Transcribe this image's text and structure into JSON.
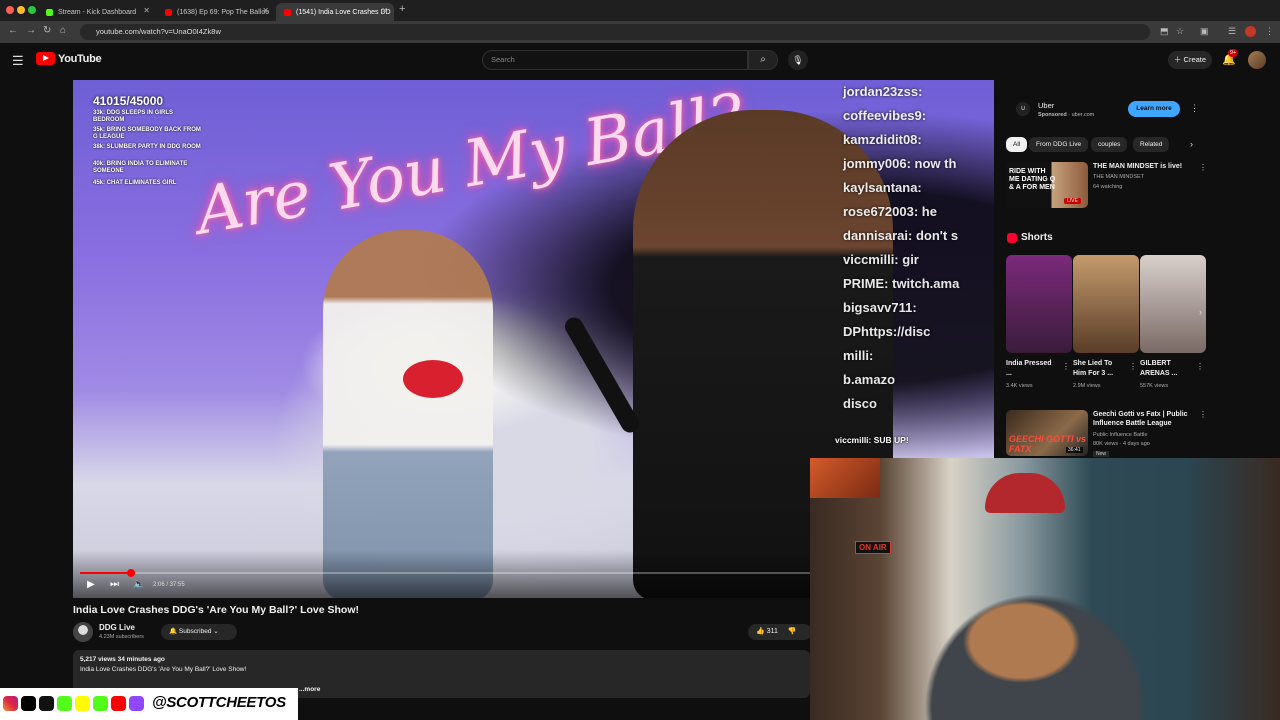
{
  "browser": {
    "tabs": [
      {
        "label": "Stream - Kick Dashboard",
        "favicon_color": "#53fc18"
      },
      {
        "label": "(1638) Ep 69: Pop The Balloo",
        "favicon_color": "#ff0000"
      },
      {
        "label": "(1541) India Love Crashes DD",
        "favicon_color": "#ff0000"
      }
    ],
    "new_tab": "+",
    "url": "youtube.com/watch?v=UnaO0I4Zk8w"
  },
  "header": {
    "logo_text": "YouTube",
    "search_placeholder": "Search",
    "create_label": "Create",
    "notif_badge": "9+"
  },
  "player": {
    "goal_title": "41015/45000",
    "goals": [
      "33k: DDG SLEEPS IN GIRLS BEDROOM",
      "35k: BRING SOMEBODY BACK FROM G LEAGUE",
      "38k: SLUMBER PARTY IN DDG ROOM",
      "40k: BRING INDIA TO ELIMINATE SOMEONE",
      "45k: CHAT ELIMINATES GIRL"
    ],
    "neon_sign": "Are You My Ball?",
    "chat_lines": [
      "jordan23zss:",
      "coffeevibes9:",
      "kamzdidit08:",
      "jommy006: now th",
      "kaylsantana:",
      "rose672003: he",
      "dannisarai: don't s",
      "viccmilli: gir",
      "PRIME: twitch.ama",
      "bigsavv711:",
      "DPhttps://disc",
      "milli:",
      "b.amazo",
      "disco"
    ],
    "sub_alert": "viccmilli: SUB UP!",
    "time": "2:06 / 37:55",
    "progress": 0.056
  },
  "video": {
    "title": "India Love Crashes DDG's 'Are You My Ball?' Love Show!",
    "channel": "DDG Live",
    "subscribers": "4.23M subscribers",
    "subscribed_label": "Subscribed",
    "likes": "311",
    "meta": "5,217 views  34 minutes ago",
    "description": "India Love Crashes DDG's 'Are You My Ball?' Love Show!",
    "more": "...more"
  },
  "social": {
    "handle": "@SCOTTCHEETOS"
  },
  "sidebar": {
    "ad": {
      "name": "Uber",
      "sponsored": "Sponsored",
      "domain": "uber.com",
      "cta": "Learn more"
    },
    "chips": [
      "All",
      "From DDG Live",
      "couples",
      "Related"
    ],
    "rec1": {
      "thumb_text": "RIDE WITH ME DATING Q & A FOR MEN",
      "live": "LIVE",
      "title": "THE MAN MINDSET  is live!",
      "channel": "THE MAN MINDSET",
      "watching": "64 watching"
    },
    "shorts_label": "Shorts",
    "shorts": [
      {
        "title": "India Pressed ...",
        "views": "3.4K views",
        "color": "#5a1f5a"
      },
      {
        "title": "She Lied To Him For 3 ...",
        "views": "2.9M views",
        "color": "#8a6a48"
      },
      {
        "title": "GILBERT ARENAS ...",
        "views": "557K views",
        "color": "#9a8c86"
      }
    ],
    "rec2": {
      "thumb_text": "GEECHI GOTTI vs FATX",
      "duration": "36:41",
      "title": "Geechi Gotti vs Fatx | Public Influence Battle League",
      "channel": "Public Influence Battle",
      "views": "80K views · 4 days ago",
      "badge": "New"
    }
  },
  "webcam": {
    "on_air": "ON AIR"
  }
}
